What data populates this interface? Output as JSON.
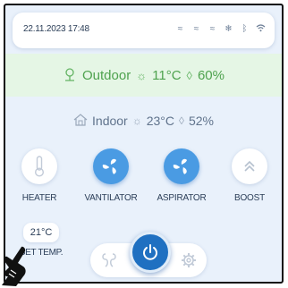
{
  "status_bar": {
    "datetime": "22.11.2023 17:48",
    "icons": [
      "wind-icon",
      "wind-icon",
      "wind-icon",
      "snowflake-icon",
      "bluetooth-icon",
      "wifi-icon"
    ]
  },
  "outdoor": {
    "label": "Outdoor",
    "temperature": "11°C",
    "humidity": "60%"
  },
  "indoor": {
    "label": "Indoor",
    "temperature": "23°C",
    "humidity": "52%"
  },
  "modes": [
    {
      "label": "HEATER",
      "active": false,
      "icon": "thermometer-icon"
    },
    {
      "label": "VANTILATOR",
      "active": true,
      "icon": "fan-icon"
    },
    {
      "label": "ASPIRATOR",
      "active": true,
      "icon": "fan-icon"
    },
    {
      "label": "BOOST",
      "active": false,
      "icon": "chevrons-up-icon"
    }
  ],
  "setpoint": {
    "value": "21°C",
    "label": "SET TEMP."
  },
  "colors": {
    "accent": "#1f70c1",
    "active_mode": "#4a9be3",
    "outdoor_band": "#e5f6e5",
    "outdoor_text": "#4ea24e",
    "background": "#e9f1fb"
  }
}
